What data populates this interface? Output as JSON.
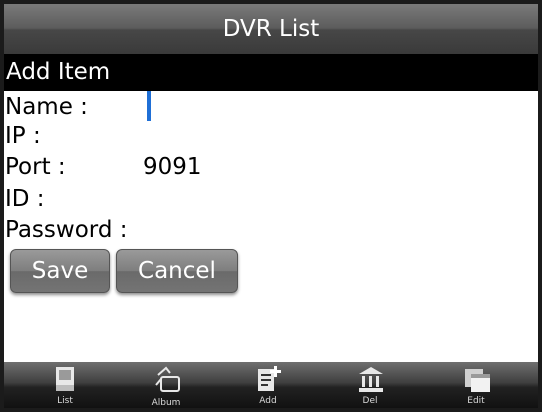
{
  "window": {
    "title": "DVR List"
  },
  "section": {
    "title": "Add Item"
  },
  "form": {
    "name_label": "Name :",
    "name_value": "",
    "ip_label": "IP :",
    "ip_value": "",
    "port_label": "Port :",
    "port_value": "9091",
    "id_label": "ID :",
    "id_value": "",
    "password_label": "Password :",
    "password_value": ""
  },
  "buttons": {
    "save": "Save",
    "cancel": "Cancel"
  },
  "toolbar": {
    "items": [
      {
        "label": "List",
        "icon": "list-icon"
      },
      {
        "label": "Album",
        "icon": "album-icon"
      },
      {
        "label": "Add",
        "icon": "add-icon"
      },
      {
        "label": "Del",
        "icon": "delete-icon"
      },
      {
        "label": "Edit",
        "icon": "edit-icon"
      }
    ]
  },
  "colors": {
    "cursor": "#1f6fd6",
    "header_bg": "#000000",
    "title_text": "#ffffff"
  }
}
